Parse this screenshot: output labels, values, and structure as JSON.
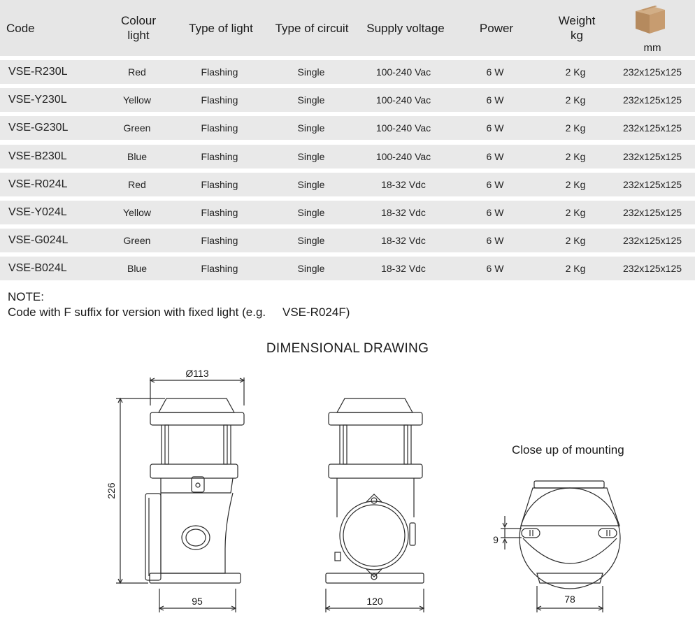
{
  "table": {
    "headers": {
      "code": "Code",
      "colour": "Colour\nlight",
      "type_light": "Type of light",
      "type_circuit": "Type of circuit",
      "voltage": "Supply voltage",
      "power": "Power",
      "weight": "Weight\nkg",
      "dimensions_unit": "mm"
    },
    "dimensions_icon": "cardboard-box-icon",
    "rows": [
      {
        "code": "VSE-R230L",
        "colour": "Red",
        "type_light": "Flashing",
        "type_circuit": "Single",
        "voltage": "100-240 Vac",
        "power": "6 W",
        "weight": "2 Kg",
        "dimensions": "232x125x125"
      },
      {
        "code": "VSE-Y230L",
        "colour": "Yellow",
        "type_light": "Flashing",
        "type_circuit": "Single",
        "voltage": "100-240 Vac",
        "power": "6 W",
        "weight": "2 Kg",
        "dimensions": "232x125x125"
      },
      {
        "code": "VSE-G230L",
        "colour": "Green",
        "type_light": "Flashing",
        "type_circuit": "Single",
        "voltage": "100-240 Vac",
        "power": "6 W",
        "weight": "2 Kg",
        "dimensions": "232x125x125"
      },
      {
        "code": "VSE-B230L",
        "colour": "Blue",
        "type_light": "Flashing",
        "type_circuit": "Single",
        "voltage": "100-240 Vac",
        "power": "6 W",
        "weight": "2 Kg",
        "dimensions": "232x125x125"
      },
      {
        "code": "VSE-R024L",
        "colour": "Red",
        "type_light": "Flashing",
        "type_circuit": "Single",
        "voltage": "18-32 Vdc",
        "power": "6 W",
        "weight": "2 Kg",
        "dimensions": "232x125x125"
      },
      {
        "code": "VSE-Y024L",
        "colour": "Yellow",
        "type_light": "Flashing",
        "type_circuit": "Single",
        "voltage": "18-32 Vdc",
        "power": "6 W",
        "weight": "2 Kg",
        "dimensions": "232x125x125"
      },
      {
        "code": "VSE-G024L",
        "colour": "Green",
        "type_light": "Flashing",
        "type_circuit": "Single",
        "voltage": "18-32 Vdc",
        "power": "6 W",
        "weight": "2 Kg",
        "dimensions": "232x125x125"
      },
      {
        "code": "VSE-B024L",
        "colour": "Blue",
        "type_light": "Flashing",
        "type_circuit": "Single",
        "voltage": "18-32 Vdc",
        "power": "6 W",
        "weight": "2 Kg",
        "dimensions": "232x125x125"
      }
    ]
  },
  "note": {
    "title": "NOTE:",
    "text": "Code with F suffix for version with fixed light (e.g.",
    "example": "VSE-R024F)"
  },
  "drawing": {
    "title": "DIMENSIONAL DRAWING",
    "diameter_label": "Ø113",
    "height_label": "226",
    "side_width_label": "95",
    "front_width_label": "120",
    "closeup_title": "Close up of mounting",
    "closeup_gap_label": "9",
    "closeup_width_label": "78"
  },
  "colors": {
    "header_bg": "#e6e6e6",
    "row_bg": "#e9e9e9",
    "line": "#2a2a2a",
    "box": "#b58a5e"
  }
}
